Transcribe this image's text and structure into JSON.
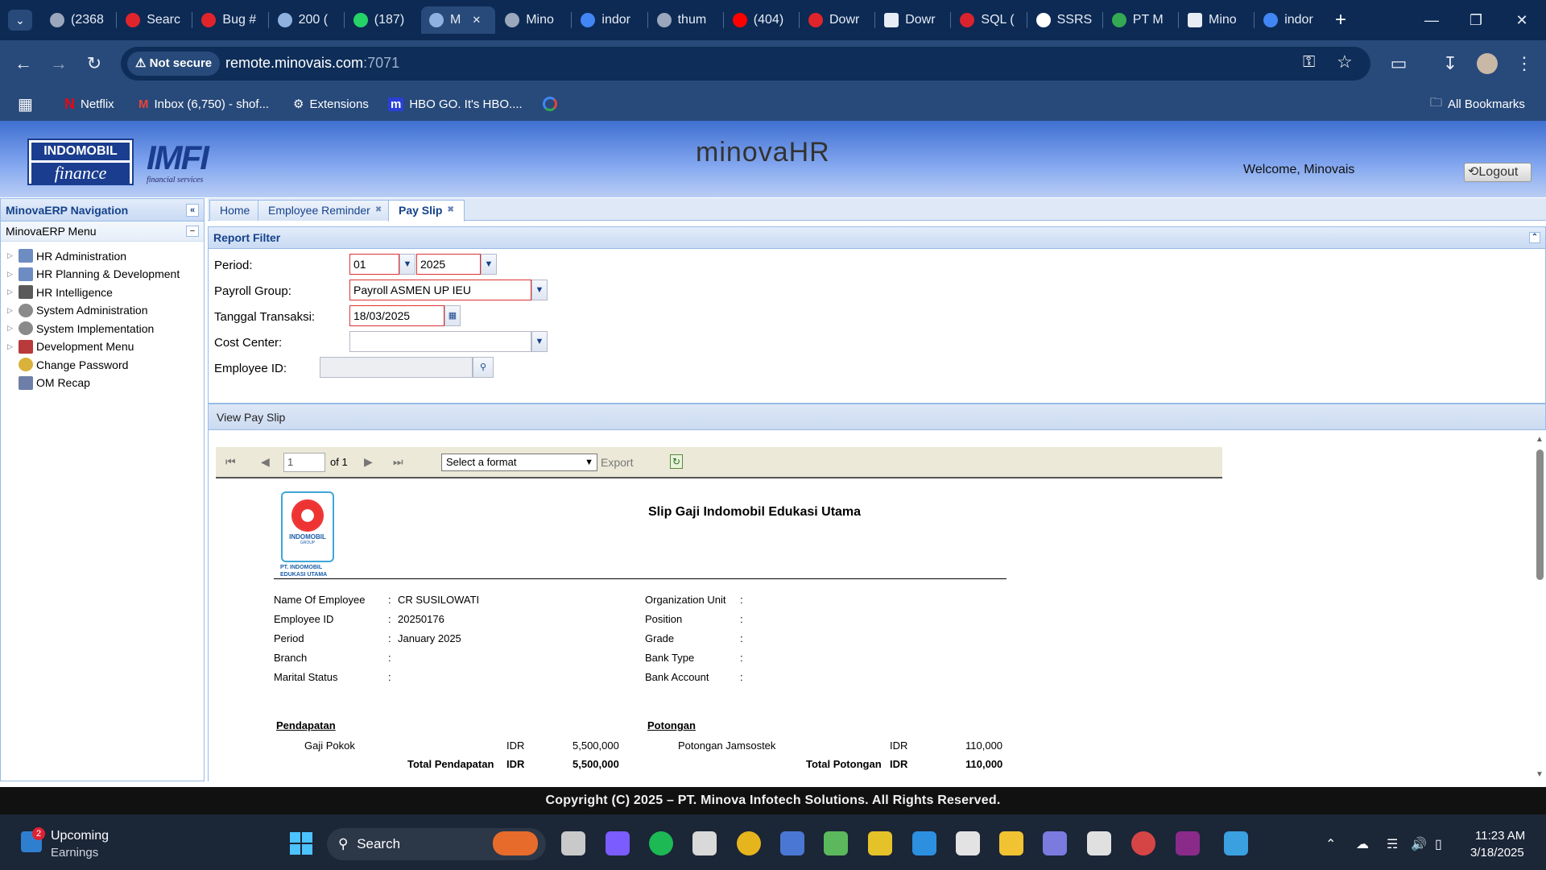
{
  "browser": {
    "tabs": [
      {
        "label": "(2368",
        "icon": "globe-icon"
      },
      {
        "label": "Searc",
        "icon": "red-hat-icon"
      },
      {
        "label": "Bug #",
        "icon": "red-hat-icon"
      },
      {
        "label": "200 (",
        "icon": "loading-icon"
      },
      {
        "label": "(187)",
        "icon": "whatsapp-icon"
      },
      {
        "label": "M",
        "icon": "loading-icon"
      },
      {
        "label": "Mino",
        "icon": "globe-icon"
      },
      {
        "label": "indor",
        "icon": "google-icon"
      },
      {
        "label": "thum",
        "icon": "globe-icon"
      },
      {
        "label": "(404)",
        "icon": "youtube-icon"
      },
      {
        "label": "Dowr",
        "icon": "red-hat-icon"
      },
      {
        "label": "Dowr",
        "icon": "download-icon"
      },
      {
        "label": "SQL (",
        "icon": "sql-icon"
      },
      {
        "label": "SSRS",
        "icon": "chatgpt-icon"
      },
      {
        "label": "PT M",
        "icon": "maps-icon"
      },
      {
        "label": "Mino",
        "icon": "report-icon"
      },
      {
        "label": "indor",
        "icon": "google-icon"
      }
    ],
    "security_label": "Not secure",
    "url_host": "remote.minovais.com",
    "url_port": ":7071",
    "bookmarks": [
      "Netflix",
      "Inbox (6,750) - shof...",
      "Extensions",
      "HBO GO. It's HBO...."
    ],
    "all_bookmarks": "All Bookmarks"
  },
  "app": {
    "logo_text_line1": "INDOMOBIL",
    "logo_text_line2": "finance",
    "logo_mark": "IMFI",
    "logo_tagline": "financial services",
    "product_logo": "minovaHR",
    "welcome": "Welcome, Minovais",
    "logout": "Logout",
    "footer": "Copyright (C) 2025 – PT. Minova Infotech Solutions. All Rights Reserved."
  },
  "nav": {
    "title": "MinovaERP Navigation",
    "menu_title": "MinovaERP Menu",
    "items": [
      {
        "label": "HR Administration",
        "icon": "table-icon",
        "expandable": true
      },
      {
        "label": "HR Planning & Development",
        "icon": "table-icon",
        "expandable": true
      },
      {
        "label": "HR Intelligence",
        "icon": "chart-icon",
        "expandable": true
      },
      {
        "label": "System Administration",
        "icon": "gear-icon",
        "expandable": true
      },
      {
        "label": "System Implementation",
        "icon": "gear-icon",
        "expandable": true
      },
      {
        "label": "Development Menu",
        "icon": "book-icon",
        "expandable": true
      },
      {
        "label": "Change Password",
        "icon": "key-icon",
        "expandable": false
      },
      {
        "label": "OM Recap",
        "icon": "form-icon",
        "expandable": false
      }
    ]
  },
  "main_tabs": [
    {
      "label": "Home",
      "closable": false,
      "active": false
    },
    {
      "label": "Employee Reminder",
      "closable": true,
      "active": false
    },
    {
      "label": "Pay Slip",
      "closable": true,
      "active": true
    }
  ],
  "filter": {
    "title": "Report Filter",
    "period_label": "Period:",
    "period_month": "01",
    "period_year": "2025",
    "payroll_group_label": "Payroll Group:",
    "payroll_group": "Payroll ASMEN UP IEU",
    "tanggal_label": "Tanggal Transaksi:",
    "tanggal": "18/03/2025",
    "cost_center_label": "Cost Center:",
    "cost_center": "",
    "employee_id_label": "Employee ID:",
    "employee_id": ""
  },
  "viewer": {
    "title": "View Pay Slip",
    "page": "1",
    "of_pages": "of 1",
    "format_select": "Select a format",
    "export": "Export"
  },
  "payslip": {
    "company_logo_text": "INDOMOBIL",
    "company_logo_sub": "GROUP",
    "company_logo_caption1": "PT. INDOMOBIL",
    "company_logo_caption2": "EDUKASI UTAMA",
    "title": "Slip Gaji Indomobil Edukasi Utama",
    "left_fields": [
      {
        "label": "Name Of Employee",
        "value": "CR SUSILOWATI"
      },
      {
        "label": "Employee ID",
        "value": "20250176"
      },
      {
        "label": "Period",
        "value": "January 2025"
      },
      {
        "label": "Branch",
        "value": ""
      },
      {
        "label": "Marital Status",
        "value": ""
      }
    ],
    "right_fields": [
      {
        "label": "Organization Unit",
        "value": ""
      },
      {
        "label": "Position",
        "value": ""
      },
      {
        "label": "Grade",
        "value": ""
      },
      {
        "label": "Bank Type",
        "value": ""
      },
      {
        "label": "Bank Account",
        "value": ""
      }
    ],
    "colon": ":",
    "pendapatan_title": "Pendapatan",
    "potongan_title": "Potongan",
    "pendapatan_item": "Gaji Pokok",
    "pendapatan_currency": "IDR",
    "pendapatan_amount": "5,500,000",
    "total_pendapatan_label": "Total Pendapatan",
    "total_pendapatan_currency": "IDR",
    "total_pendapatan_amount": "5,500,000",
    "potongan_item": "Potongan Jamsostek",
    "potongan_currency": "IDR",
    "potongan_amount": "110,000",
    "total_potongan_label": "Total Potongan",
    "total_potongan_currency": "IDR",
    "total_potongan_amount": "110,000"
  },
  "taskbar": {
    "widget_badge": "2",
    "widget_line1": "Upcoming",
    "widget_line2": "Earnings",
    "search": "Search",
    "time": "11:23 AM",
    "date": "3/18/2025"
  }
}
